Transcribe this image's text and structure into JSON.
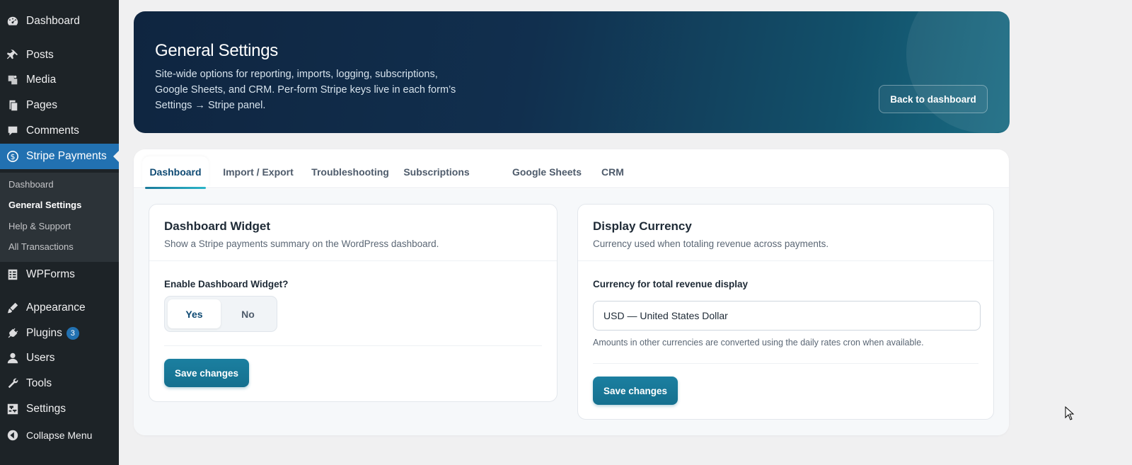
{
  "sidebar": {
    "items": [
      {
        "label": "Dashboard",
        "icon": "dashboard-icon"
      },
      {
        "label": "Posts",
        "icon": "pin-icon"
      },
      {
        "label": "Media",
        "icon": "media-icon"
      },
      {
        "label": "Pages",
        "icon": "pages-icon"
      },
      {
        "label": "Comments",
        "icon": "comment-icon"
      },
      {
        "label": "Stripe Payments",
        "icon": "dollar-icon"
      },
      {
        "label": "WPForms",
        "icon": "form-icon"
      },
      {
        "label": "Appearance",
        "icon": "brush-icon"
      },
      {
        "label": "Plugins",
        "icon": "plugin-icon",
        "badge": "3"
      },
      {
        "label": "Users",
        "icon": "user-icon"
      },
      {
        "label": "Tools",
        "icon": "wrench-icon"
      },
      {
        "label": "Settings",
        "icon": "settings-icon"
      },
      {
        "label": "Collapse Menu",
        "icon": "collapse-icon"
      }
    ],
    "submenu": [
      "Dashboard",
      "General Settings",
      "Help & Support",
      "All Transactions"
    ],
    "accent_color": "#2271b1"
  },
  "hero": {
    "title": "General Settings",
    "description": "Site-wide options for reporting, imports, logging, subscriptions, Google Sheets, and CRM. Per-form Stripe keys live in each form’s Settings → Stripe panel.",
    "back_button": "Back to dashboard"
  },
  "tabs": [
    "Dashboard",
    "Import / Export",
    "Troubleshooting",
    "Subscriptions",
    "Google Sheets",
    "CRM"
  ],
  "widget_card": {
    "title": "Dashboard Widget",
    "subtitle": "Show a Stripe payments summary on the WordPress dashboard.",
    "field_label": "Enable Dashboard Widget?",
    "option_yes": "Yes",
    "option_no": "No",
    "selected": "Yes",
    "save_label": "Save changes"
  },
  "currency_card": {
    "title": "Display Currency",
    "subtitle": "Currency used when totaling revenue across payments.",
    "field_label": "Currency for total revenue display",
    "selected_value": "USD — United States Dollar",
    "hint": "Amounts in other currencies are converted using the daily rates cron when available.",
    "save_label": "Save changes"
  },
  "colors": {
    "primary_button": "#15708f",
    "hero_start": "#0f2540",
    "hero_end": "#196b82"
  }
}
